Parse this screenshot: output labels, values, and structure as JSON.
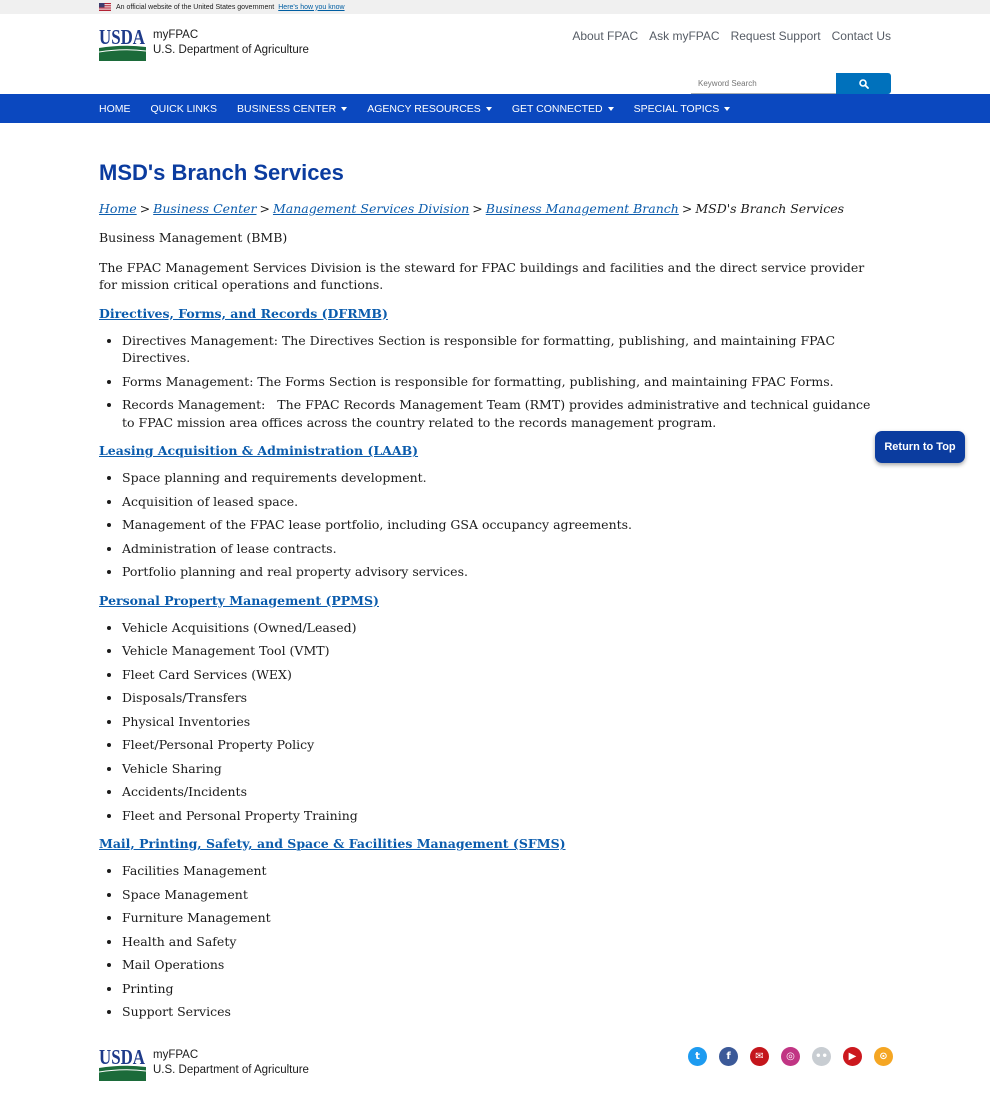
{
  "gov_banner": {
    "text": "An official website of the United States government",
    "link": "Here's how you know"
  },
  "header": {
    "logo_mark": "USDA",
    "site_name": "myFPAC",
    "department": "U.S. Department of Agriculture",
    "utility_nav": [
      "About FPAC",
      "Ask myFPAC",
      "Request Support",
      "Contact Us"
    ],
    "search_placeholder": "Keyword Search"
  },
  "main_nav": [
    {
      "label": "HOME",
      "dropdown": false
    },
    {
      "label": "QUICK LINKS",
      "dropdown": false
    },
    {
      "label": "BUSINESS CENTER",
      "dropdown": true
    },
    {
      "label": "AGENCY RESOURCES",
      "dropdown": true
    },
    {
      "label": "GET CONNECTED",
      "dropdown": true
    },
    {
      "label": "SPECIAL TOPICS",
      "dropdown": true
    }
  ],
  "page": {
    "title": "MSD's Branch Services",
    "breadcrumb": {
      "links": [
        "Home",
        "Business Center",
        "Management Services Division",
        "Business Management Branch"
      ],
      "current": "MSD's Branch Services",
      "separator": ">"
    },
    "subtitle": "Business Management (BMB)",
    "intro": "The FPAC Management Services Division is the steward for FPAC buildings and facilities and the direct service provider for mission critical operations and functions.",
    "sections": [
      {
        "title": "Directives, Forms, and Records (DFRMB)",
        "items": [
          "Directives Management: The Directives Section is responsible for formatting, publishing, and maintaining FPAC Directives.",
          "Forms Management: The Forms Section is responsible for formatting, publishing, and maintaining FPAC Forms.",
          "Records Management:   The FPAC Records Management Team (RMT) provides administrative and technical guidance to FPAC mission area offices across the country related to the records management program."
        ]
      },
      {
        "title": "Leasing Acquisition & Administration (LAAB)",
        "items": [
          "Space planning and requirements development.",
          "Acquisition of leased space.",
          "Management of the FPAC lease portfolio, including GSA occupancy agreements.",
          "Administration of lease contracts.",
          "Portfolio planning and real property advisory services."
        ]
      },
      {
        "title": "Personal Property Management (PPMS)",
        "items": [
          "Vehicle Acquisitions (Owned/Leased)",
          "Vehicle Management Tool (VMT)",
          "Fleet Card Services (WEX)",
          "Disposals/Transfers",
          "Physical Inventories",
          "Fleet/Personal Property Policy",
          "Vehicle Sharing",
          "Accidents/Incidents",
          "Fleet and Personal Property Training"
        ]
      },
      {
        "title": "Mail, Printing, Safety, and Space & Facilities Management (SFMS)",
        "items": [
          "Facilities Management",
          "Space Management",
          "Furniture Management",
          "Health and Safety",
          "Mail Operations",
          "Printing",
          "Support Services"
        ]
      }
    ]
  },
  "return_to_top": "Return to Top",
  "footer": {
    "logo_mark": "USDA",
    "site_name": "myFPAC",
    "department": "U.S. Department of Agriculture",
    "social": [
      {
        "icon": "twitter-icon",
        "color": "#1d9bf0",
        "glyph": "t"
      },
      {
        "icon": "facebook-icon",
        "color": "#3b5998",
        "glyph": "f"
      },
      {
        "icon": "blog-icon",
        "color": "#c4161c",
        "glyph": "✉"
      },
      {
        "icon": "instagram-icon",
        "color": "#c13584",
        "glyph": "◎"
      },
      {
        "icon": "flickr-icon",
        "color": "#c8cdd2",
        "glyph": "••"
      },
      {
        "icon": "youtube-icon",
        "color": "#cc181e",
        "glyph": "▶"
      },
      {
        "icon": "rss-icon",
        "color": "#f5a623",
        "glyph": "⊙"
      }
    ]
  },
  "colors": {
    "nav_blue": "#0b48bf",
    "title_blue": "#0b3c9f",
    "link_blue": "#0b5cad",
    "usda_green": "#1c6b3a",
    "usda_blue": "#1e3a8a",
    "search_button": "#0071bc"
  }
}
